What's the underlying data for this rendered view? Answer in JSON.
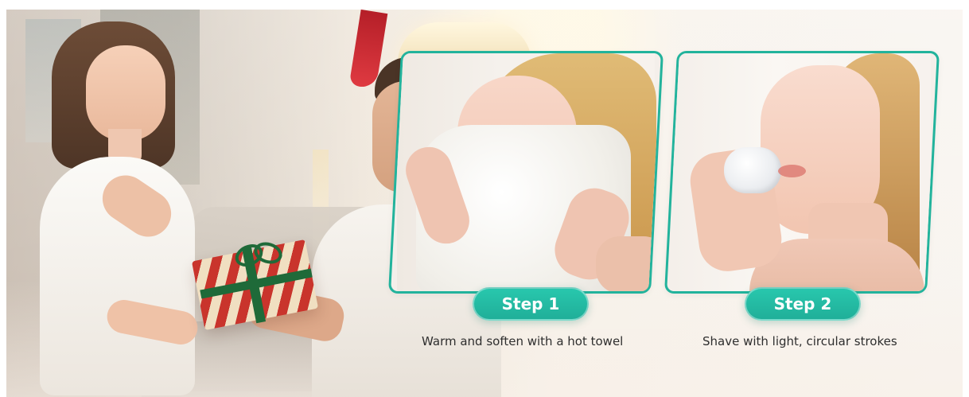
{
  "steps": [
    {
      "label": "Step 1",
      "caption": "Warm and soften with a hot towel"
    },
    {
      "label": "Step 2",
      "caption": "Shave with light, circular strokes"
    }
  ],
  "colors": {
    "accent": "#22b39c",
    "caption_text": "#2e2e2e"
  }
}
